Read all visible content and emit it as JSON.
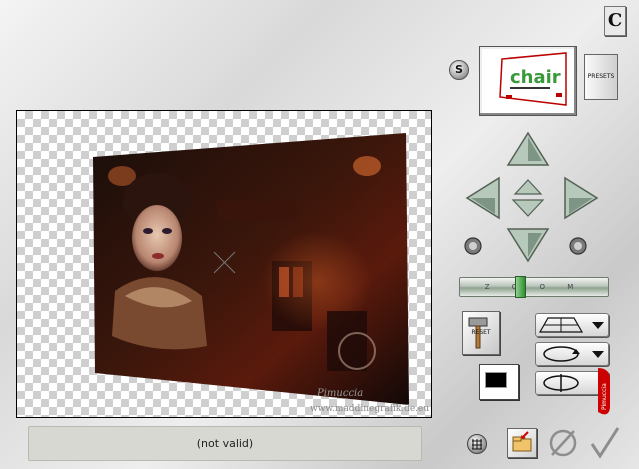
{
  "app": {
    "corner_logo": "C"
  },
  "status": {
    "text": "(not valid)"
  },
  "preset": {
    "thumbnail_text": "chair",
    "button_label": "PRESETS"
  },
  "buttons": {
    "s_label": "S",
    "reset_label": "RESET"
  },
  "zoom": {
    "label": "Z O O M",
    "value": 0.4
  },
  "watermark": {
    "line1": "Pimuccia",
    "line2": "www.maddinegrafik.de.eu"
  },
  "tag": {
    "text": "Pimuccia"
  },
  "icons": {
    "corner": "c-logo-icon",
    "grid": "grid-icon",
    "folder": "folder-open-icon",
    "cancel": "cancel-icon",
    "ok": "checkmark-icon",
    "up": "arrow-up-icon",
    "down": "arrow-down-icon",
    "left": "arrow-left-icon",
    "right": "arrow-right-icon",
    "center_up": "small-arrow-up-icon",
    "center_down": "small-arrow-down-icon",
    "rotate_left": "rotate-left-knob-icon",
    "rotate_right": "rotate-right-knob-icon",
    "perspective": "perspective-grid-icon",
    "rotate_mode": "rotate-ellipse-icon",
    "flip_mode": "flip-ellipse-icon"
  },
  "colors": {
    "accent_green": "#2f8f2f",
    "tag_red": "#cc0000",
    "status_bg": "#d8d8d2"
  }
}
